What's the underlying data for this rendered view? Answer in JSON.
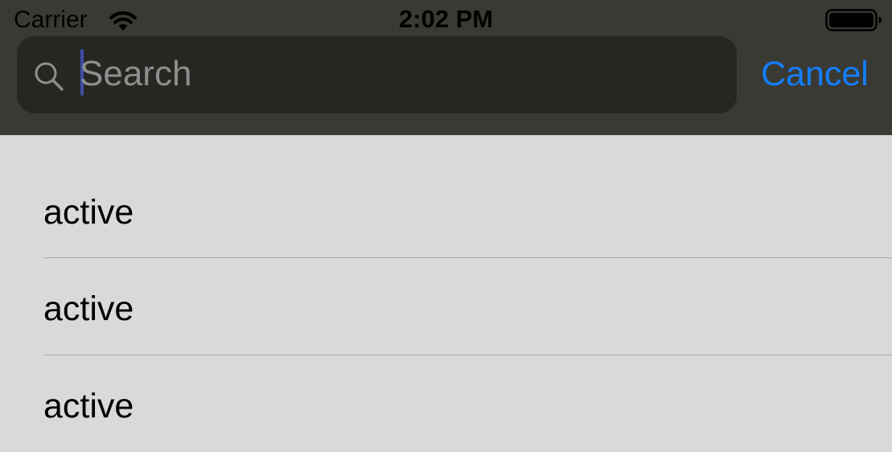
{
  "status_bar": {
    "carrier": "Carrier",
    "time": "2:02 PM",
    "wifi_icon": "wifi-icon",
    "battery_icon": "battery-icon"
  },
  "search": {
    "placeholder": "Search",
    "value": "",
    "icon": "search-icon",
    "cancel_label": "Cancel"
  },
  "results": {
    "items": [
      {
        "label": "active"
      },
      {
        "label": "active"
      },
      {
        "label": "active"
      }
    ]
  },
  "colors": {
    "header_background": "#3a3a34",
    "search_field_background": "#262722",
    "list_background": "#d9d9d9",
    "accent": "#147efb",
    "caret": "#3e4ea8"
  }
}
